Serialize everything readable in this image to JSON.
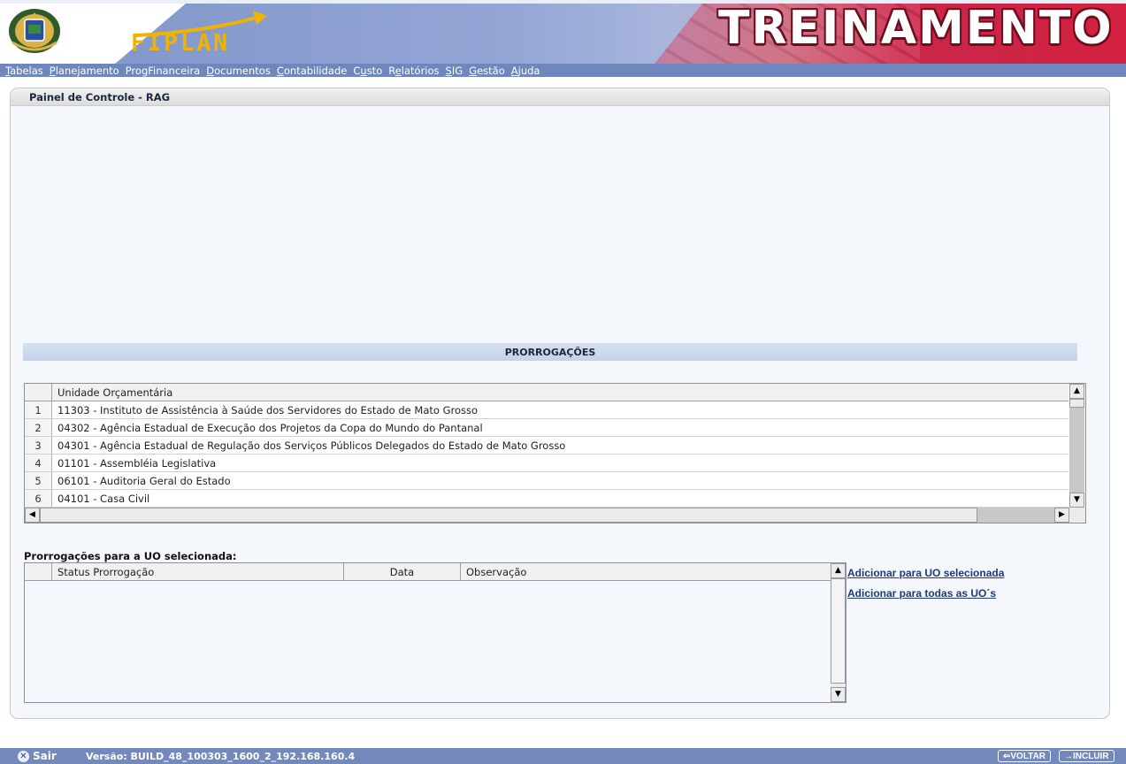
{
  "header": {
    "logo_text": "FIPLAN",
    "banner_text": "TREINAMENTO"
  },
  "menu": [
    {
      "u": "T",
      "rest": "abelas"
    },
    {
      "u": "P",
      "rest": "lanejamento"
    },
    {
      "u": "",
      "pre": "Pro",
      "u2": "g",
      "rest": "Financeira"
    },
    {
      "u": "D",
      "rest": "ocumentos"
    },
    {
      "u": "C",
      "rest": "ontabilidade"
    },
    {
      "pre": "C",
      "u2": "u",
      "rest": "sto"
    },
    {
      "pre": "R",
      "u2": "e",
      "rest": "latórios"
    },
    {
      "u": "S",
      "rest": "IG"
    },
    {
      "u": "G",
      "rest": "estão"
    },
    {
      "u": "A",
      "rest": "juda"
    }
  ],
  "panel": {
    "title": "Painel de Controle - RAG",
    "section_title": "PRORROGAÇÕES"
  },
  "uo_grid": {
    "header": "Unidade Orçamentária",
    "rows": [
      {
        "n": "1",
        "text": "11303 - Instituto de Assistência à Saúde dos Servidores do Estado de Mato Grosso"
      },
      {
        "n": "2",
        "text": "04302 - Agência Estadual de Execução dos Projetos da Copa do Mundo do Pantanal"
      },
      {
        "n": "3",
        "text": "04301 - Agência Estadual de Regulação dos Serviços Públicos Delegados do Estado de Mato Grosso"
      },
      {
        "n": "4",
        "text": "01101 - Assembléia Legislativa"
      },
      {
        "n": "5",
        "text": "06101 - Auditoria Geral do Estado"
      },
      {
        "n": "6",
        "text": "04101 - Casa Civil"
      }
    ]
  },
  "prorrogacoes": {
    "title": "Prorrogações para a UO selecionada:",
    "columns": [
      "Status Prorrogação",
      "Data",
      "Observação"
    ],
    "link_selected": "Adicionar para UO selecionada",
    "link_all": "Adicionar para todas as UO´s"
  },
  "footer": {
    "exit_label": "Sair",
    "version": "Versão: BUILD_48_100303_1600_2_192.168.160.4",
    "back_label": "VOLTAR",
    "include_label": "INCLUIR"
  }
}
